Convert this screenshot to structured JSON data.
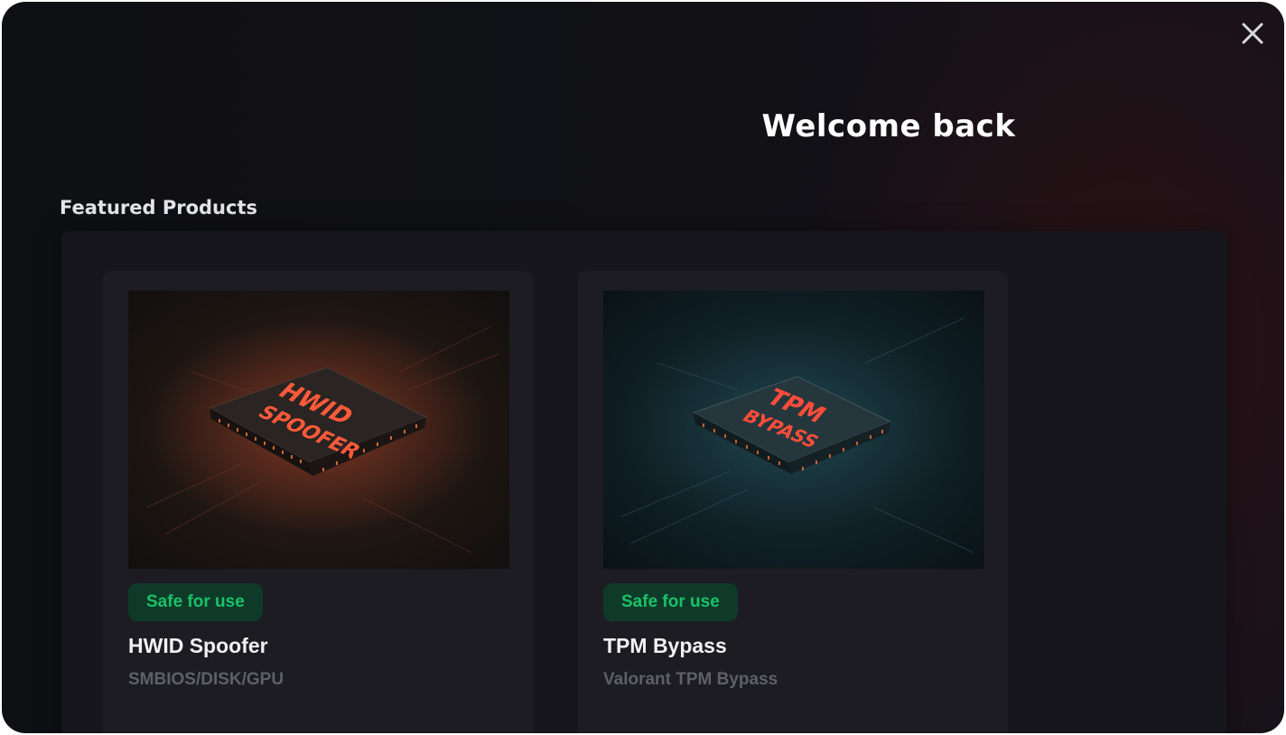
{
  "header": {
    "welcome_title": "Welcome back"
  },
  "window": {
    "close_icon": "close-icon"
  },
  "featured": {
    "section_title": "Featured Products",
    "products": [
      {
        "image_icon": "chip-image",
        "image_text_line1": "HWID",
        "image_text_line2": "SPOOFER",
        "badge": "Safe for use",
        "title": "HWID Spoofer",
        "subtitle": "SMBIOS/DISK/GPU",
        "image_color": "#2a1a14"
      },
      {
        "image_icon": "chip-image",
        "image_text_line1": "TPM",
        "image_text_line2": "BYPASS",
        "badge": "Safe for use",
        "title": "TPM Bypass",
        "subtitle": "Valorant TPM Bypass",
        "image_color": "#0f2a30"
      }
    ]
  },
  "colors": {
    "background": "#111116",
    "badge_bg": "#0f3a29",
    "badge_text": "#19c267",
    "chip_glow": "#ff5a3a"
  }
}
